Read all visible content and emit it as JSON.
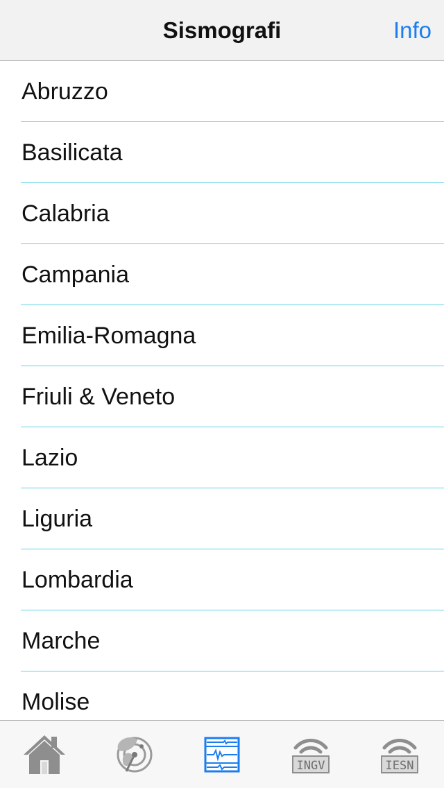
{
  "navbar": {
    "title": "Sismografi",
    "info_label": "Info"
  },
  "list": {
    "items": [
      {
        "label": "Abruzzo"
      },
      {
        "label": "Basilicata"
      },
      {
        "label": "Calabria"
      },
      {
        "label": "Campania"
      },
      {
        "label": "Emilia-Romagna"
      },
      {
        "label": "Friuli & Veneto"
      },
      {
        "label": "Lazio"
      },
      {
        "label": "Liguria"
      },
      {
        "label": "Lombardia"
      },
      {
        "label": "Marche"
      },
      {
        "label": "Molise"
      }
    ]
  },
  "tabbar": {
    "tabs": [
      {
        "icon": "home-icon",
        "active": false
      },
      {
        "icon": "radar-icon",
        "active": false
      },
      {
        "icon": "seismograph-icon",
        "active": true
      },
      {
        "icon": "ingv-signal-icon",
        "label": "INGV",
        "active": false
      },
      {
        "icon": "iesn-signal-icon",
        "label": "IESN",
        "active": false
      }
    ]
  },
  "colors": {
    "accent": "#1a7ef0",
    "separator": "#5fd2e6",
    "inactive_icon": "#8e8e8e"
  }
}
